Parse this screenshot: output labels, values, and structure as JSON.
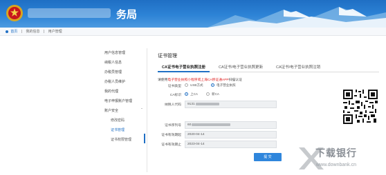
{
  "header": {
    "title_suffix": "务局"
  },
  "breadcrumb": {
    "home": "首页",
    "sep1": "|",
    "my_info": "我的信息",
    "sep2": "|",
    "current": "用户管理"
  },
  "sidebar": {
    "items": [
      {
        "label": "用户信息管理"
      },
      {
        "label": "纳税人信息"
      },
      {
        "label": "办税员管理"
      },
      {
        "label": "办税人员维护"
      },
      {
        "label": "我的代理"
      },
      {
        "label": "电子申报账户管理"
      },
      {
        "label": "账户安全"
      },
      {
        "label": "修改密码"
      },
      {
        "label": "证书管理"
      },
      {
        "label": "证书权限管理"
      }
    ]
  },
  "main": {
    "title": "证书管理",
    "tabs": [
      {
        "label": "CA证书电子营业执照注册",
        "active": true
      },
      {
        "label": "CA证书/电子营业执照更新"
      },
      {
        "label": "CA证书/电子营业执照注销"
      }
    ],
    "notice_pre": "请使用",
    "notice_red": "电子营业执照小程序或上海CA移证通APP",
    "notice_post": "扫描认证",
    "cert_type": {
      "label": "证书类型",
      "options": [
        "USB方式",
        "电子营业执照"
      ],
      "selected": 1
    },
    "ca_id": {
      "label": "CA标识",
      "options": [
        "上CA",
        "新CA"
      ],
      "selected": 0
    },
    "taxpayer_id": {
      "label": "纳税人代码",
      "value": "9131"
    },
    "cert_serial": {
      "label": "证书序列号",
      "value": "60"
    },
    "valid_start": {
      "label": "证书有效期起",
      "value": "2020-04-14"
    },
    "valid_end": {
      "label": "证书有效期止",
      "value": "2023-04-14"
    },
    "submit_label": "提 交"
  },
  "watermark": {
    "text": "下载银行",
    "url": "www.downbank.cn"
  },
  "colors": {
    "primary": "#1f6fc4",
    "notice_red": "#e02020"
  }
}
